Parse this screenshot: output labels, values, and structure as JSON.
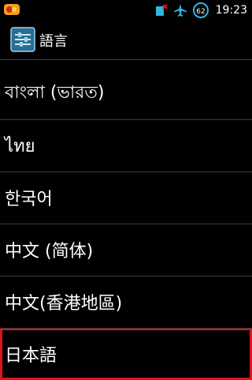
{
  "status_bar": {
    "app_icon": "notification-app-icon",
    "icons": [
      "sim-error-icon",
      "airplane-mode-icon"
    ],
    "battery_level": "62",
    "time": "19:23"
  },
  "action_bar": {
    "icon": "settings-icon",
    "title": "語言"
  },
  "languages": [
    {
      "label": "বাংলা (ভারত)"
    },
    {
      "label": "ไทย"
    },
    {
      "label": "한국어"
    },
    {
      "label": "中文 (简体)"
    },
    {
      "label": "中文(香港地區)"
    },
    {
      "label": "日本語",
      "highlighted": true
    }
  ],
  "colors": {
    "background": "#000000",
    "divider": "#3a3a3a",
    "highlight": "#e0131b",
    "accent": "#33b5e5"
  }
}
